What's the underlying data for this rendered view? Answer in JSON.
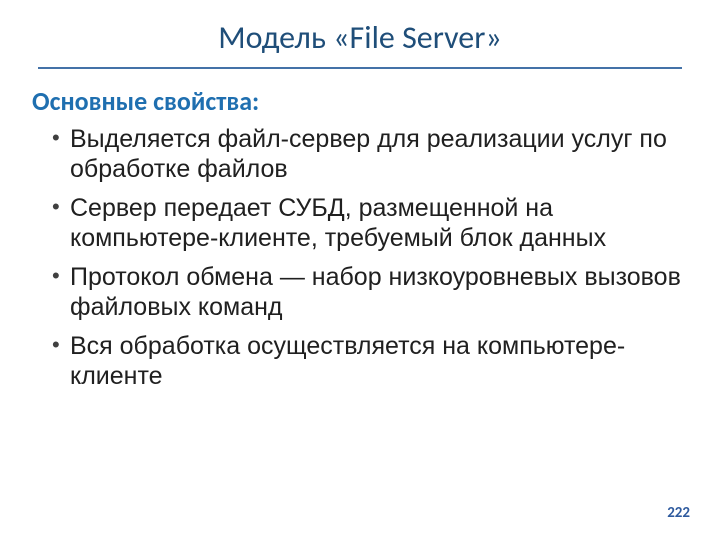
{
  "title": "Модель «File Server»",
  "subtitle": "Основные свойства:",
  "bullets": [
    "Выделяется файл-сервер для реализации услуг по обработке файлов",
    "Сервер передает СУБД, размещенной на компьютере-клиенте, требуемый блок данных",
    "Протокол обмена — набор низкоуровневых вызовов файловых команд",
    "Вся обработка осуществляется на компьютере-клиенте"
  ],
  "page_number": "222"
}
